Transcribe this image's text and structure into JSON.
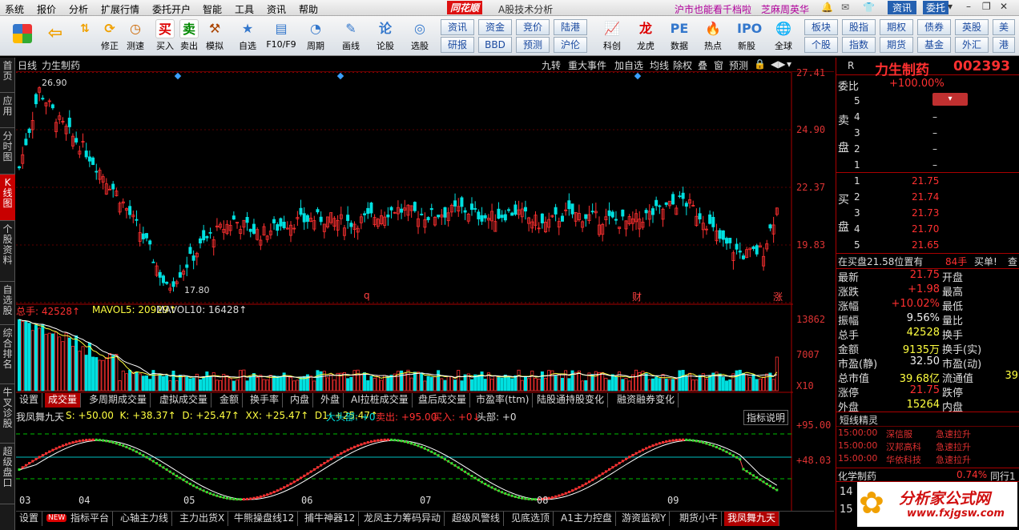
{
  "menubar": {
    "items": [
      "系统",
      "报价",
      "分析",
      "扩展行情",
      "委托开户",
      "智能",
      "工具",
      "资讯",
      "帮助"
    ],
    "brand": "同花顺",
    "subtitle": "A股技术分析",
    "promo1": "沪市也能看千档啦",
    "promo2": "芝麻周英华",
    "btn_info": "资讯",
    "btn_trade": "委托"
  },
  "toolbar": {
    "buttons": [
      "修正",
      "测速",
      "买入",
      "卖出",
      "模拟",
      "自选",
      "F10/F9",
      "周期",
      "画线",
      "论股",
      "选股"
    ],
    "grid": [
      "资讯",
      "资金",
      "竞价",
      "陆港",
      "研报",
      "BBD",
      "预测",
      "沪伦"
    ],
    "icons2": [
      "科创",
      "龙虎",
      "数据",
      "热点",
      "新股"
    ],
    "global": "全球",
    "grid2": [
      "板块",
      "股指",
      "期权",
      "债券",
      "英股",
      "个股",
      "指数",
      "期货",
      "基金",
      "外汇"
    ]
  },
  "leftnav": [
    "首页",
    "应用",
    "分时图",
    "K线图",
    "个股资料",
    "自选股",
    "综合排名",
    "牛叉诊股",
    "超级盘口"
  ],
  "chart": {
    "period": "日线",
    "stock_name": "力生制药",
    "top_buttons": [
      "九转",
      "重大事件",
      "加自选",
      "均线",
      "除权",
      "叠",
      "窗",
      "预测"
    ],
    "price_axis": [
      "27.41",
      "24.90",
      "22.37",
      "19.83"
    ],
    "high_label": "26.90",
    "low_label": "17.80",
    "markers": [
      "q",
      "财",
      "涨"
    ],
    "volume_title": "总手: 42528↑",
    "mavol5": "MAVOL5: 20929↑",
    "mavol10": "MAVOL10: 16428↑",
    "vol_axis": [
      "13862",
      "7007"
    ],
    "vol_unit": "X10",
    "vol_tabs": [
      "设置",
      "成交量",
      "多周期成交量",
      "虚拟成交量",
      "金额",
      "换手率",
      "内盘",
      "外盘",
      "AI拉桩成交量",
      "盘后成交量",
      "市盈率(ttm)",
      "陆股通持股变化",
      "融资融券变化"
    ],
    "ind_name": "我凤舞九天",
    "ind_values": "S: +50.00  K: +38.37↑  D: +25.47↑  XX: +25.47↑  D1: +25.47↑",
    "ind_extra1": "大头部: +0",
    "ind_extra2": "卖出: +95.00",
    "ind_extra3": "买入: +0↓",
    "ind_extra4": "头部: +0",
    "ind_help": "指标说明",
    "ind_axis": [
      "+95.00",
      "+48.03"
    ],
    "months": [
      "03",
      "04",
      "05",
      "06",
      "07",
      "08",
      "09"
    ],
    "bottom_tabs": [
      "设置",
      "指标平台",
      "心轴主力线",
      "主力出货X",
      "牛熊操盘线12",
      "捕牛神器12",
      "龙凤主力筹码异动",
      "超级风警线",
      "见底选顶",
      "A1主力控盘",
      "游资监视Y",
      "期货小牛",
      "我凤舞九天"
    ],
    "new_badge": "NEW"
  },
  "quote": {
    "r": "R",
    "name": "力生制药",
    "code": "002393",
    "weibi_label": "委比",
    "weibi": "+100.00%",
    "sell_label": [
      "卖",
      "盘"
    ],
    "sell": [
      {
        "n": "5",
        "p": "",
        "v": ""
      },
      {
        "n": "4",
        "p": "–",
        "v": ""
      },
      {
        "n": "3",
        "p": "–",
        "v": ""
      },
      {
        "n": "2",
        "p": "–",
        "v": ""
      },
      {
        "n": "1",
        "p": "–",
        "v": ""
      }
    ],
    "buy_label": [
      "买",
      "盘"
    ],
    "buy": [
      {
        "n": "1",
        "p": "21.75"
      },
      {
        "n": "2",
        "p": "21.74"
      },
      {
        "n": "3",
        "p": "21.73"
      },
      {
        "n": "4",
        "p": "21.70"
      },
      {
        "n": "5",
        "p": "21.65"
      }
    ],
    "notice": "在买盘21.58位置有",
    "notice_vol": "84手",
    "notice_act": "买单!",
    "notice_more": "查",
    "stats": [
      {
        "l": "最新",
        "v": "21.75",
        "l2": "开盘"
      },
      {
        "l": "涨跌",
        "v": "+1.98",
        "l2": "最高"
      },
      {
        "l": "涨幅",
        "v": "+10.02%",
        "l2": "最低"
      },
      {
        "l": "振幅",
        "v": "9.56%",
        "l2": "量比"
      },
      {
        "l": "总手",
        "v": "42528",
        "l2": "换手"
      },
      {
        "l": "金额",
        "v": "9135万",
        "l2": "换手(实)"
      },
      {
        "l": "市盈(静)",
        "v": "32.50",
        "l2": "市盈(动)"
      },
      {
        "l": "总市值",
        "v": "39.68亿",
        "l2": "流通值"
      },
      {
        "l": "涨停",
        "v": "21.75",
        "l2": "跌停"
      },
      {
        "l": "外盘",
        "v": "15264",
        "l2": "内盘"
      }
    ],
    "liutong_tail": "39",
    "news_title": "短线精灵",
    "news": [
      {
        "t": "15:00:00",
        "s": "深信服",
        "e": "急速拉升"
      },
      {
        "t": "15:00:00",
        "s": "汉邦高科",
        "e": "急速拉升"
      },
      {
        "t": "15:00:00",
        "s": "华依科技",
        "e": "急速拉升"
      }
    ],
    "sector": "化学制药",
    "sector_pct": "0.74%",
    "sector_more": "同行1",
    "bottom_nums": [
      "14",
      "15"
    ],
    "watermark": "分析家公式网",
    "watermark_url": "www.fxjgsw.com"
  }
}
